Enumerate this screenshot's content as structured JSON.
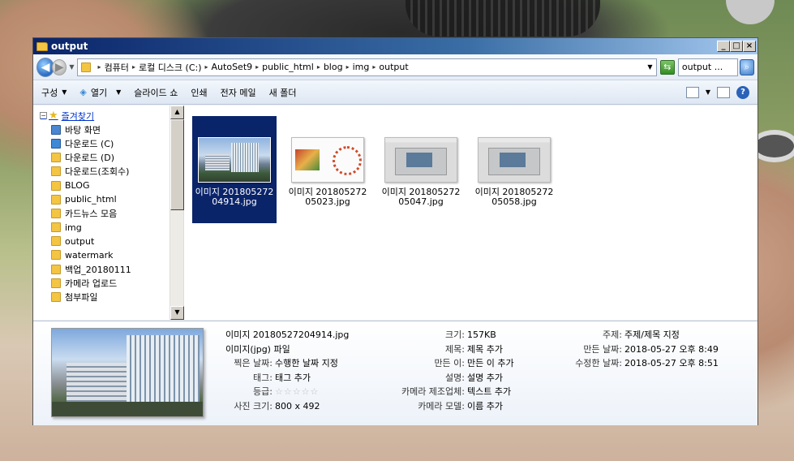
{
  "window": {
    "title": "output"
  },
  "address": {
    "crumbs": [
      "컴퓨터",
      "로컬 디스크 (C:)",
      "AutoSet9",
      "public_html",
      "blog",
      "img",
      "output"
    ],
    "search_value": "output ..."
  },
  "toolbar": {
    "organize": "구성",
    "open": "열기",
    "slideshow": "슬라이드 쇼",
    "print": "인쇄",
    "email": "전자 메일",
    "new_folder": "새 폴더"
  },
  "nav": {
    "favorites": "즐겨찾기",
    "items": [
      {
        "label": "바탕 화면",
        "kind": "desk"
      },
      {
        "label": "다운로드 (C)",
        "kind": "dl"
      },
      {
        "label": "다운로드 (D)",
        "kind": "folder"
      },
      {
        "label": "다운로드(조회수)",
        "kind": "folder"
      },
      {
        "label": "BLOG",
        "kind": "folder"
      },
      {
        "label": "public_html",
        "kind": "folder"
      },
      {
        "label": "카드뉴스 모음",
        "kind": "folder"
      },
      {
        "label": "img",
        "kind": "folder"
      },
      {
        "label": "output",
        "kind": "folder"
      },
      {
        "label": "watermark",
        "kind": "folder"
      },
      {
        "label": "백업_20180111",
        "kind": "folder"
      },
      {
        "label": "카메라 업로드",
        "kind": "folder"
      },
      {
        "label": "첨부파일",
        "kind": "folder"
      }
    ]
  },
  "files": [
    {
      "label": "이미지 20180527204914.jpg",
      "thumb": "hotel",
      "selected": true
    },
    {
      "label": "이미지 20180527205023.jpg",
      "thumb": "slide",
      "selected": false
    },
    {
      "label": "이미지 20180527205047.jpg",
      "thumb": "shot",
      "selected": false
    },
    {
      "label": "이미지 20180527205058.jpg",
      "thumb": "shot",
      "selected": false
    }
  ],
  "details": {
    "col1": [
      {
        "k": "",
        "v": "이미지 20180527204914.jpg"
      },
      {
        "k": "",
        "v": "이미지(jpg) 파일"
      },
      {
        "k": "찍은 날짜:",
        "v": "수행한 날짜 지정"
      },
      {
        "k": "태그:",
        "v": "태그 추가"
      },
      {
        "k": "등급:",
        "v": "☆☆☆☆☆"
      },
      {
        "k": "사진 크기:",
        "v": "800 x 492"
      }
    ],
    "col2": [
      {
        "k": "크기:",
        "v": "157KB"
      },
      {
        "k": "제목:",
        "v": "제목 추가"
      },
      {
        "k": "만든 이:",
        "v": "만든 이 추가"
      },
      {
        "k": "설명:",
        "v": "설명 추가"
      },
      {
        "k": "카메라 제조업체:",
        "v": "텍스트 추가"
      },
      {
        "k": "카메라 모델:",
        "v": "이름 추가"
      }
    ],
    "col3": [
      {
        "k": "주제:",
        "v": "주제/제목 지정"
      },
      {
        "k": "만든 날짜:",
        "v": "2018-05-27 오후 8:49"
      },
      {
        "k": "수정한 날짜:",
        "v": "2018-05-27 오후 8:51"
      }
    ]
  }
}
